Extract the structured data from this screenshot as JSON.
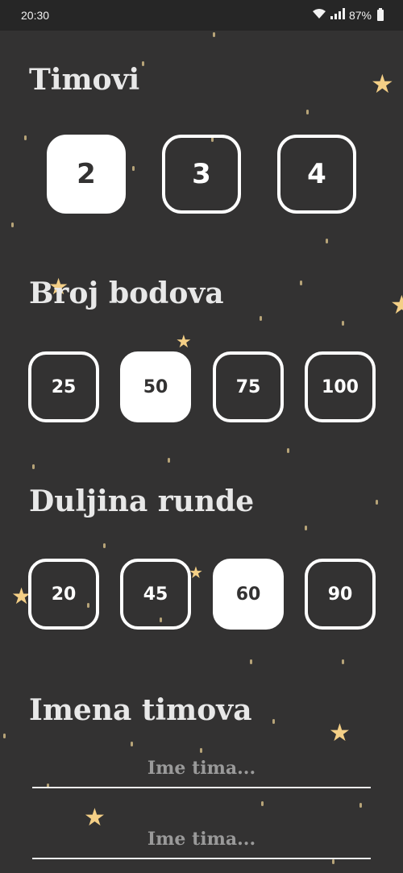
{
  "status": {
    "time": "20:30",
    "battery": "87%"
  },
  "sections": {
    "teams": {
      "title": "Timovi",
      "options": [
        "2",
        "3",
        "4"
      ],
      "selected": "2"
    },
    "points": {
      "title": "Broj bodova",
      "options": [
        "25",
        "50",
        "75",
        "100"
      ],
      "selected": "50"
    },
    "round": {
      "title": "Duljina runde",
      "options": [
        "20",
        "45",
        "60",
        "90"
      ],
      "selected": "60"
    },
    "names": {
      "title": "Imena timova",
      "placeholders": [
        "Ime tima...",
        "Ime tima..."
      ]
    }
  },
  "colors": {
    "background": "#333232",
    "accent": "#ffffff",
    "star": "#f4cf86"
  }
}
